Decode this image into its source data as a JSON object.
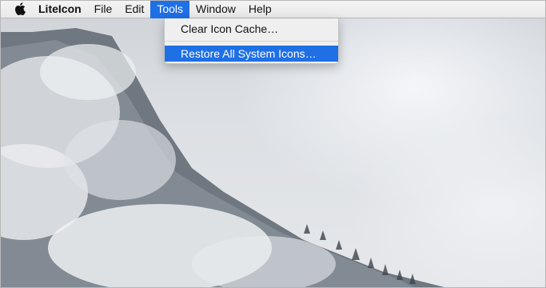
{
  "menubar": {
    "apple_icon": "apple-icon",
    "items": [
      {
        "label": "LiteIcon"
      },
      {
        "label": "File"
      },
      {
        "label": "Edit"
      },
      {
        "label": "Tools"
      },
      {
        "label": "Window"
      },
      {
        "label": "Help"
      }
    ]
  },
  "tools_menu": {
    "items": [
      {
        "label": "Clear Icon Cache…"
      },
      {
        "label": "Restore All System Icons…"
      }
    ]
  },
  "colors": {
    "highlight": "#1f6fe5"
  }
}
